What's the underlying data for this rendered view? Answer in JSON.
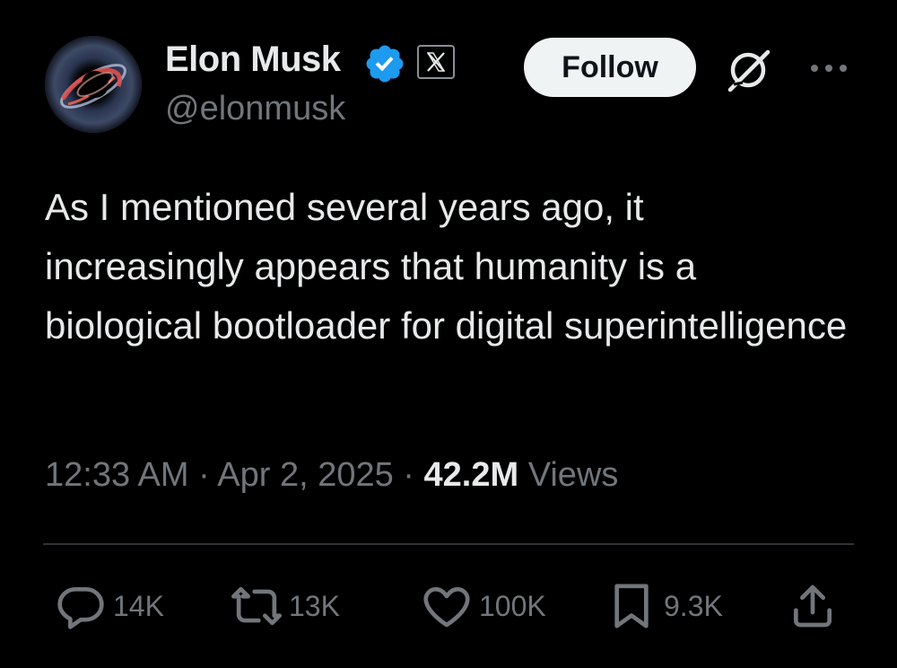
{
  "author": {
    "name": "Elon Musk",
    "handle": "@elonmusk"
  },
  "header": {
    "follow_label": "Follow"
  },
  "tweet": {
    "text": "As I mentioned several years ago, it increasingly appears that humanity is a biological bootloader for digital superintelligence",
    "time": "12:33 AM",
    "separator": "·",
    "date": "Apr 2, 2025",
    "views_count": "42.2M",
    "views_label": "Views"
  },
  "actions": {
    "replies": "14K",
    "reposts": "13K",
    "likes": "100K",
    "bookmarks": "9.3K"
  },
  "colors": {
    "background": "#000000",
    "text": "#e7e9ea",
    "muted": "#71767b",
    "verified": "#1d9bf0",
    "follow_button": "#eff3f4"
  },
  "icons": [
    "verified-badge-icon",
    "x-affiliation-icon",
    "grok-icon",
    "more-icon",
    "reply-icon",
    "repost-icon",
    "like-icon",
    "bookmark-icon",
    "share-icon"
  ]
}
